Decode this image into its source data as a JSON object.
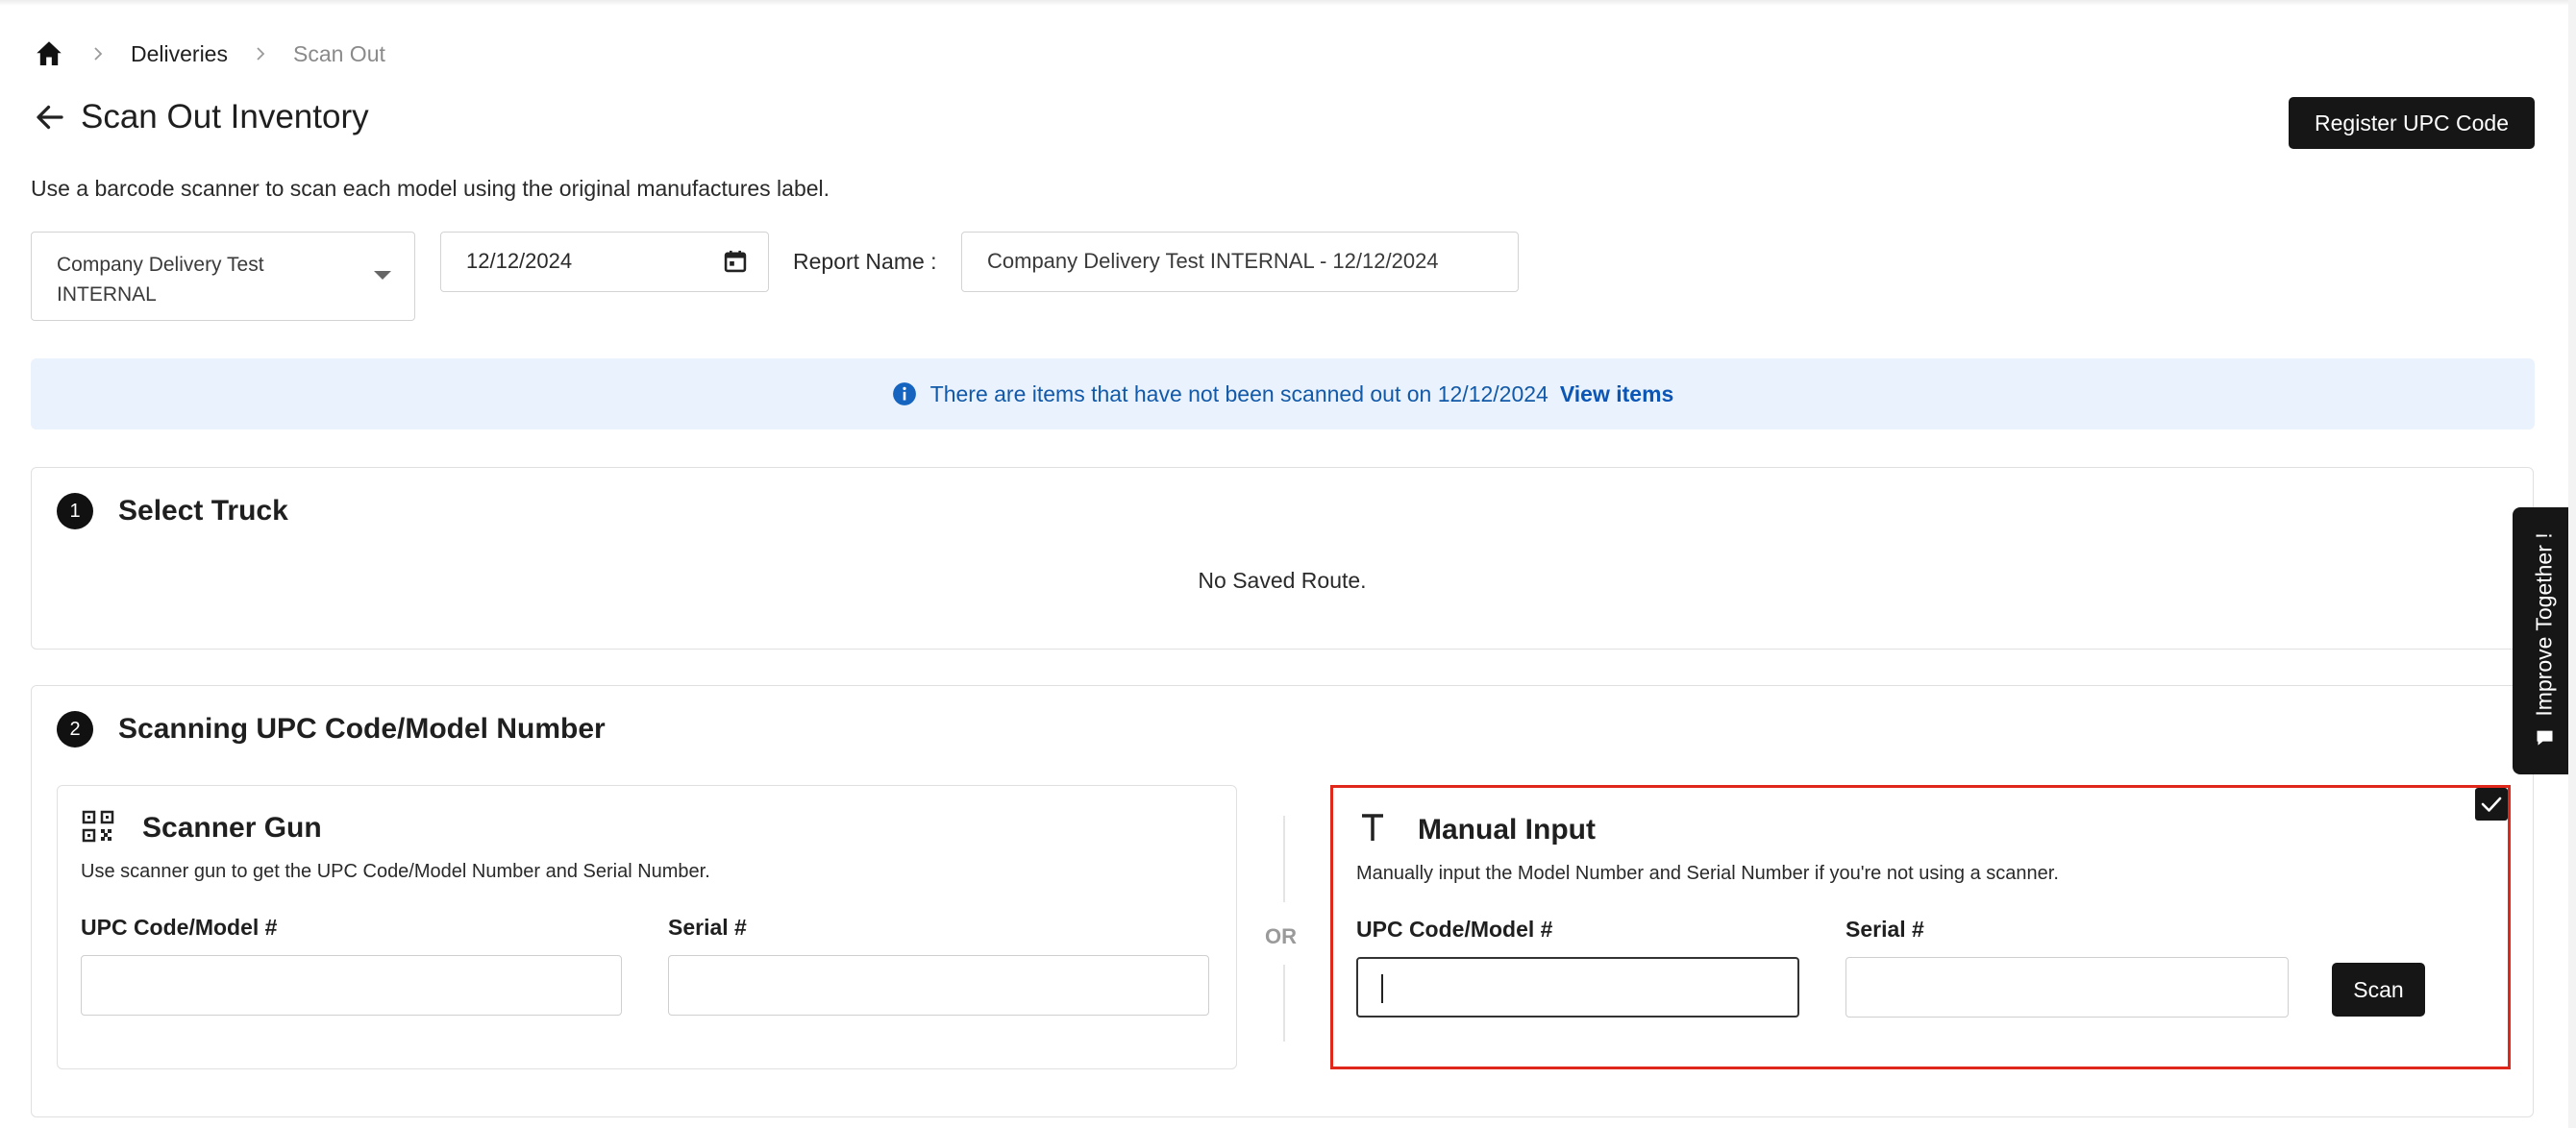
{
  "breadcrumb": {
    "home_icon": "home-icon",
    "items": [
      "Deliveries"
    ],
    "current": "Scan Out"
  },
  "header": {
    "title": "Scan Out Inventory",
    "register_button": "Register UPC Code"
  },
  "intro_text": "Use a barcode scanner to scan each model using the original manufactures label.",
  "filters": {
    "company_select": "Company Delivery Test INTERNAL",
    "date": "12/12/2024",
    "report_name_label": "Report Name :",
    "report_name_value": "Company Delivery Test INTERNAL - 12/12/2024"
  },
  "banner": {
    "text": "There are items that have not been scanned out on 12/12/2024",
    "link": "View items",
    "color": "#1259a8",
    "background": "#eaf2fd"
  },
  "step1": {
    "number": "1",
    "title": "Select Truck",
    "empty_text": "No Saved Route."
  },
  "step2": {
    "number": "2",
    "title": "Scanning UPC Code/Model Number",
    "or_text": "OR",
    "scanner": {
      "icon": "qr-code-icon",
      "title": "Scanner Gun",
      "description": "Use scanner gun to get the UPC Code/Model Number and Serial Number.",
      "upc_label": "UPC Code/Model #",
      "upc_value": "",
      "serial_label": "Serial #",
      "serial_value": ""
    },
    "manual": {
      "icon": "text-t-icon",
      "title": "Manual Input",
      "description": "Manually input the Model Number and Serial Number if you're not using a scanner.",
      "upc_label": "UPC Code/Model #",
      "upc_value": "",
      "serial_label": "Serial #",
      "serial_value": "",
      "scan_button": "Scan",
      "selected": true,
      "highlight_color": "#e0271b"
    }
  },
  "feedback_tab": {
    "label": "Improve Together !",
    "icon": "chat-bubble-icon"
  }
}
